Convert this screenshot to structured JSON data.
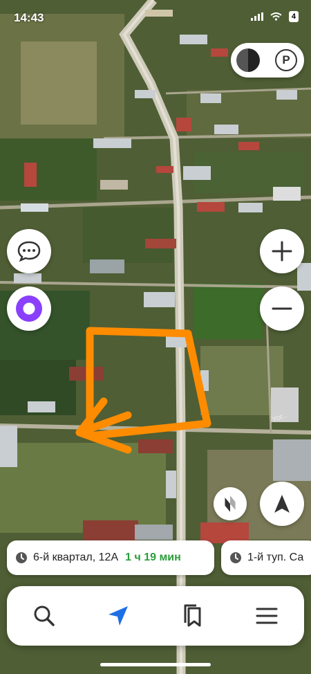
{
  "status_bar": {
    "time": "14:43",
    "battery": "4"
  },
  "map": {
    "road_label": "Yor.."
  },
  "route_cards": [
    {
      "destination": "6-й квартал, 12А",
      "eta": "1 ч 19 мин"
    },
    {
      "destination": "1-й туп. Са",
      "eta": ""
    }
  ],
  "top_controls": {
    "parking_label": "P"
  },
  "bottom_nav": [
    "search-icon",
    "navigator-arrow-icon",
    "bookmarks-icon",
    "menu-icon"
  ],
  "colors": {
    "annotation_orange": "#ff8c00",
    "accent_blue": "#1e6fe6",
    "alice_purple": "#8a3ffc",
    "eta_green": "#2a9d3a"
  }
}
